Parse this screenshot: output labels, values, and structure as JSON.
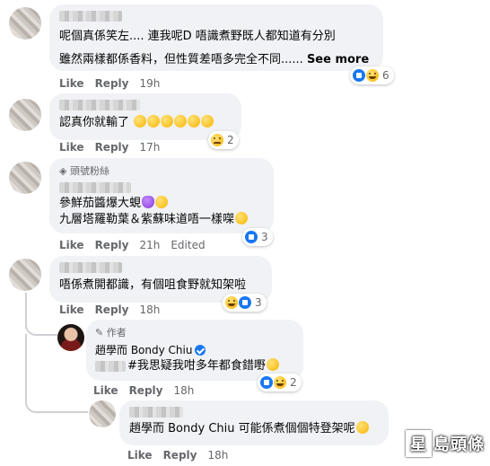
{
  "comments": [
    {
      "text_lines": [
        "呢個真係笑左.... 連我呢D 唔識煮野既人都知道有分別",
        "雖然兩樣都係香料，但性質差唔多完全不同......"
      ],
      "see_more": "See more",
      "like": "Like",
      "reply": "Reply",
      "time": "19h",
      "reaction_count": "6"
    },
    {
      "text": "認真你就輸了",
      "like": "Like",
      "reply": "Reply",
      "time": "17h",
      "reaction_count": "2"
    },
    {
      "badge": "頭號粉絲",
      "text_lines": [
        "參鮮茄醬爆大蜆",
        "九層塔羅勒葉＆紫蘇味道唔一樣㗎"
      ],
      "like": "Like",
      "reply": "Reply",
      "time": "21h",
      "edited": "Edited",
      "reaction_count": "3"
    },
    {
      "text": "唔係煮開都識，有個咀食野就知架啦",
      "like": "Like",
      "reply": "Reply",
      "time": "18h",
      "reaction_count": "3",
      "replies": [
        {
          "author_tag": "作者",
          "author_name": "趙學而 Bondy Chiu",
          "text": "#我思疑我咁多年都食錯嘢",
          "like": "Like",
          "reply": "Reply",
          "time": "18h",
          "reaction_count": "2"
        },
        {
          "text": "趙學而 Bondy Chiu 可能係煮個個特登架呢",
          "like": "Like",
          "reply": "Reply",
          "time": "18h"
        }
      ]
    }
  ],
  "watermark": {
    "box": "星",
    "rest": "島頭條"
  }
}
